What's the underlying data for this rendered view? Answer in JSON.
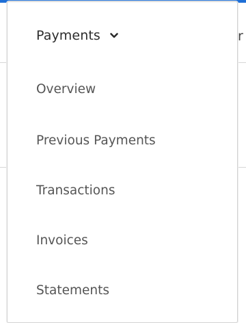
{
  "menu": {
    "title": "Payments",
    "expanded_icon": "chevron-down-icon",
    "items": [
      {
        "label": "Overview"
      },
      {
        "label": "Previous Payments"
      },
      {
        "label": "Transactions"
      },
      {
        "label": "Invoices"
      },
      {
        "label": "Statements"
      }
    ]
  },
  "colors": {
    "accent": "#1f6fd6",
    "text_primary": "#2b2b2b",
    "text_secondary": "#555555",
    "border": "#d2d2d2"
  }
}
